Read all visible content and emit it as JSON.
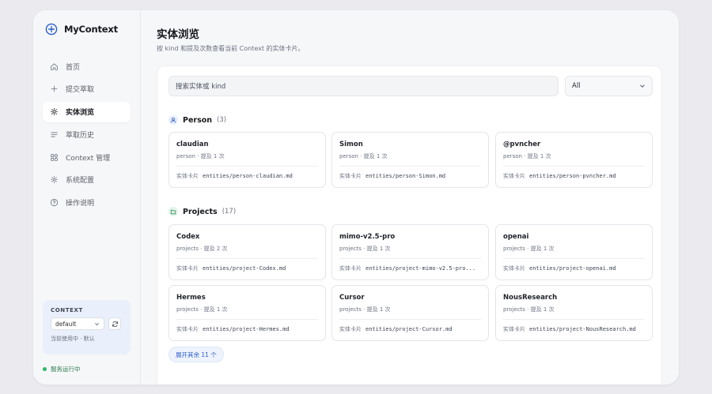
{
  "app": {
    "name": "MyContext"
  },
  "sidebar": {
    "items": [
      {
        "label": "首页",
        "icon": "home-icon",
        "active": false
      },
      {
        "label": "提交萃取",
        "icon": "plus-icon",
        "active": false
      },
      {
        "label": "实体浏览",
        "icon": "sparkle-icon",
        "active": true
      },
      {
        "label": "萃取历史",
        "icon": "list-icon",
        "active": false
      },
      {
        "label": "Context 管理",
        "icon": "grid-icon",
        "active": false
      },
      {
        "label": "系统配置",
        "icon": "gear-icon",
        "active": false
      },
      {
        "label": "操作说明",
        "icon": "help-icon",
        "active": false
      }
    ],
    "context": {
      "title": "CONTEXT",
      "selected": "default",
      "status": "当前使用中 · 默认"
    },
    "service": "服务运行中"
  },
  "page": {
    "title": "实体浏览",
    "subtitle": "按 kind 和提及次数查看当前 Context 的实体卡片。"
  },
  "search": {
    "placeholder": "搜索实体或 kind"
  },
  "filter": {
    "selected": "All"
  },
  "card_label": "实体卡片",
  "sections": [
    {
      "name": "Person",
      "count": "(3)",
      "icon": "person-icon",
      "cards": [
        {
          "title": "claudian",
          "meta": "person · 提及 1 次",
          "path": "entities/person-claudian.md"
        },
        {
          "title": "Simon",
          "meta": "person · 提及 1 次",
          "path": "entities/person-Simon.md"
        },
        {
          "title": "@pvncher",
          "meta": "person · 提及 1 次",
          "path": "entities/person-pvncher.md"
        }
      ]
    },
    {
      "name": "Projects",
      "count": "(17)",
      "icon": "folder-icon",
      "cards": [
        {
          "title": "Codex",
          "meta": "projects · 提及 2 次",
          "path": "entities/project-Codex.md"
        },
        {
          "title": "mimo-v2.5-pro",
          "meta": "projects · 提及 1 次",
          "path": "entities/project-mimo-v2.5-pro..."
        },
        {
          "title": "openai",
          "meta": "projects · 提及 1 次",
          "path": "entities/project-openai.md"
        },
        {
          "title": "Hermes",
          "meta": "projects · 提及 1 次",
          "path": "entities/project-Hermes.md"
        },
        {
          "title": "Cursor",
          "meta": "projects · 提及 1 次",
          "path": "entities/project-Cursor.md"
        },
        {
          "title": "NousResearch",
          "meta": "projects · 提及 1 次",
          "path": "entities/project-NousResearch.md"
        }
      ]
    }
  ],
  "expand_label": "展开其余 11 个",
  "colors": {
    "accent": "#2c5ec7",
    "success": "#2fb768",
    "person_bg": "#e6eefc",
    "project_bg": "#e4f4ea"
  }
}
